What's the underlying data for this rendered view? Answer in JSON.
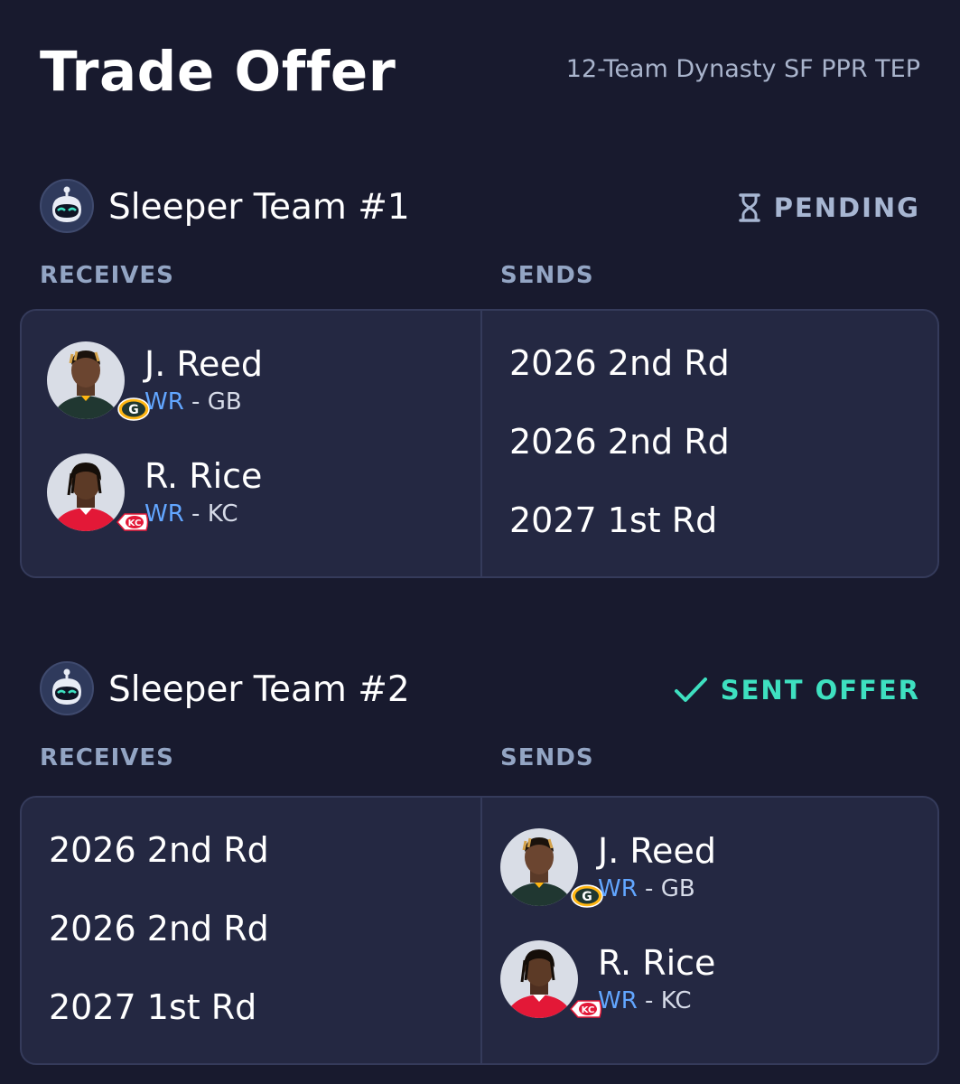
{
  "header": {
    "title": "Trade Offer",
    "league": "12-Team Dynasty SF PPR TEP"
  },
  "labels": {
    "receives": "RECEIVES",
    "sends": "SENDS"
  },
  "teams": [
    {
      "name": "Sleeper Team #1",
      "avatar_icon": "sleeper-robot-icon",
      "status": "PENDING",
      "status_icon": "hourglass-icon",
      "status_color": "#a7b6d2",
      "receives": [
        {
          "name": "J. Reed",
          "position": "WR",
          "sep": " - ",
          "team": "GB",
          "team_logo": "packers-logo"
        },
        {
          "name": "R. Rice",
          "position": "WR",
          "sep": " - ",
          "team": "KC",
          "team_logo": "chiefs-logo"
        }
      ],
      "sends": [
        "2026 2nd Rd",
        "2026 2nd Rd",
        "2027 1st Rd"
      ]
    },
    {
      "name": "Sleeper Team #2",
      "avatar_icon": "sleeper-robot-icon",
      "status": "SENT OFFER",
      "status_icon": "checkmark-icon",
      "status_color": "#3ee0c0",
      "receives": [
        "2026 2nd Rd",
        "2026 2nd Rd",
        "2027 1st Rd"
      ],
      "sends": [
        {
          "name": "J. Reed",
          "position": "WR",
          "sep": " - ",
          "team": "GB",
          "team_logo": "packers-logo"
        },
        {
          "name": "R. Rice",
          "position": "WR",
          "sep": " - ",
          "team": "KC",
          "team_logo": "chiefs-logo"
        }
      ]
    }
  ],
  "colors": {
    "background": "#181a2e",
    "card": "#242842",
    "position": "#62a6ff"
  }
}
